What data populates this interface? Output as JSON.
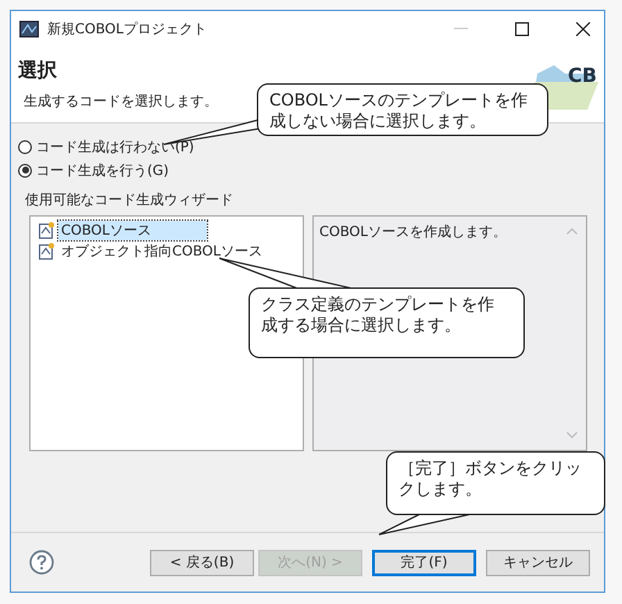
{
  "window": {
    "title": "新規COBOLプロジェクト"
  },
  "header": {
    "title": "選択",
    "description": "生成するコードを選択します。",
    "logo_text": "CB"
  },
  "options": [
    {
      "label": "コード生成は行わない(P)",
      "selected": false
    },
    {
      "label": "コード生成を行う(G)",
      "selected": true
    }
  ],
  "wizards": {
    "label": "使用可能なコード生成ウィザード",
    "items": [
      {
        "label": "COBOLソース",
        "selected": true
      },
      {
        "label": "オブジェクト指向COBOLソース",
        "selected": false
      }
    ],
    "description": "COBOLソースを作成します。"
  },
  "buttons": [
    {
      "label": "< 戻る(B)",
      "disabled": false,
      "default": false
    },
    {
      "label": "次へ(N) >",
      "disabled": true,
      "default": false
    },
    {
      "label": "完了(F)",
      "disabled": false,
      "default": true
    },
    {
      "label": "キャンセル",
      "disabled": false,
      "default": false
    }
  ],
  "callouts": [
    {
      "text": "COBOLソースのテンプレートを作成しない場合に選択します。"
    },
    {
      "text": "クラス定義のテンプレートを作成する場合に選択します。"
    },
    {
      "text": "［完了］ボタンをクリックします。"
    }
  ]
}
